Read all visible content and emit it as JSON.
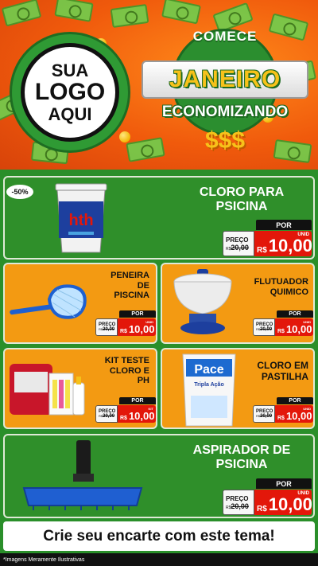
{
  "header": {
    "logo_lines": [
      "SUA",
      "LOGO",
      "AQUI"
    ],
    "comece": "COMECE",
    "janeiro": "JANEIRO",
    "economizando": "ECONOMIZANDO",
    "dollars": "$$$"
  },
  "colors": {
    "orange": "#f39a12",
    "green": "#2f8f2a",
    "red_price": "#e3170a",
    "header_orange": "#f05a0c",
    "gold": "#f7c21a"
  },
  "discount_badge": "-50%",
  "products": [
    {
      "title_lines": [
        "CLORO PARA",
        "PSICINA"
      ],
      "preco_label": "PREÇO",
      "old": "20,00",
      "old_prefix": "R$",
      "por": "POR",
      "rs": "R$",
      "value": "10,00",
      "unit": "UNID"
    },
    {
      "title_lines": [
        "PENEIRA",
        "DE",
        "PISCINA"
      ],
      "preco_label": "PREÇO",
      "old": "20,00",
      "old_prefix": "R$",
      "por": "POR",
      "rs": "R$",
      "value": "10,00",
      "unit": "UNID"
    },
    {
      "title_lines": [
        "FLUTUADOR",
        "QUIMICO"
      ],
      "preco_label": "PREÇO",
      "old": "20,00",
      "old_prefix": "R$",
      "por": "POR",
      "rs": "R$",
      "value": "10,00",
      "unit": "UNID"
    },
    {
      "title_lines": [
        "KIT TESTE",
        "CLORO E",
        "PH"
      ],
      "preco_label": "PREÇO",
      "old": "20,00",
      "old_prefix": "R$",
      "por": "POR",
      "rs": "R$",
      "value": "10,00",
      "unit": "KIT"
    },
    {
      "title_lines": [
        "CLORO EM",
        "PASTILHA"
      ],
      "preco_label": "PREÇO",
      "old": "20,00",
      "old_prefix": "R$",
      "por": "POR",
      "rs": "R$",
      "value": "10,00",
      "unit": "UNID"
    },
    {
      "title_lines": [
        "ASPIRADOR DE",
        "PSICINA"
      ],
      "preco_label": "PREÇO",
      "old": "20,00",
      "old_prefix": "R$",
      "por": "POR",
      "rs": "R$",
      "value": "10,00",
      "unit": "UNID"
    }
  ],
  "product_art": {
    "hth_brand": "hth",
    "pace_brand": "Pace",
    "pace_sub": "Tripla Ação"
  },
  "footer": {
    "cta": "Crie seu encarte com este tema!",
    "disclaimer": "*Imagens Meramente Ilustrativas"
  }
}
